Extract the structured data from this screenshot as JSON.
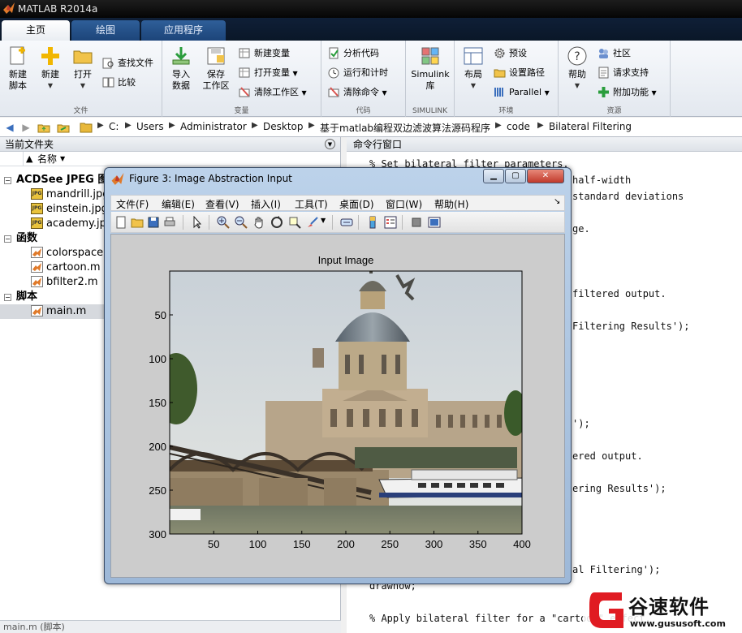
{
  "window": {
    "title": "MATLAB R2014a"
  },
  "tabs": [
    {
      "label": "主页"
    },
    {
      "label": "绘图"
    },
    {
      "label": "应用程序"
    }
  ],
  "ribbon": {
    "file_group": {
      "label": "文件",
      "new_script": "新建\n脚本",
      "new": "新建",
      "open": "打开",
      "find_files": "查找文件",
      "compare": "比较"
    },
    "variable_group": {
      "label": "变量",
      "import": "导入\n数据",
      "save_ws": "保存\n工作区",
      "new_var": "新建变量",
      "open_var": "打开变量",
      "clear_ws": "清除工作区"
    },
    "code_group": {
      "label": "代码",
      "analyze": "分析代码",
      "run_time": "运行和计时",
      "clear_cmd": "清除命令"
    },
    "simulink_group": {
      "label": "SIMULINK",
      "simulink_lib": "Simulink\n库"
    },
    "env_group": {
      "label": "环境",
      "layout": "布局",
      "prefs": "预设",
      "set_path": "设置路径",
      "parallel": "Parallel"
    },
    "resources_group": {
      "label": "资源",
      "help": "帮助",
      "community": "社区",
      "request_support": "请求支持",
      "addons": "附加功能"
    }
  },
  "address": {
    "path": [
      "C:",
      "Users",
      "Administrator",
      "Desktop",
      "基于matlab编程双边滤波算法源码程序",
      "code",
      "Bilateral Filtering"
    ]
  },
  "current_folder": {
    "title": "当前文件夹",
    "col_name": "名称",
    "sections": [
      {
        "label": "ACDSee JPEG 图像",
        "items": [
          "mandrill.jpg",
          "einstein.jpg",
          "academy.jpg"
        ]
      },
      {
        "label": "函数",
        "items": [
          "colorspace.m",
          "cartoon.m",
          "bfilter2.m"
        ]
      },
      {
        "label": "脚本",
        "items": [
          "main.m"
        ]
      }
    ],
    "status": "main.m (脚本)"
  },
  "command_window": {
    "title": "命令行窗口",
    "lines": [
      "% Set bilateral filter parameters.",
      "half-width",
      "standard deviations",
      "ge.",
      "filtered output.",
      "Filtering Results');",
      "');",
      "ered output.",
      "ering Results');",
      "al Filtering');",
      "drawnow;",
      "% Apply bilateral filter for a \"cartoon\" effect."
    ]
  },
  "figure": {
    "title": "Figure 3: Image Abstraction Input",
    "menu": [
      "文件(F)",
      "编辑(E)",
      "查看(V)",
      "插入(I)",
      "工具(T)",
      "桌面(D)",
      "窗口(W)",
      "帮助(H)"
    ],
    "menu_end": "↘"
  },
  "chart_data": {
    "type": "image",
    "title": "Input Image",
    "xlim": [
      0,
      400
    ],
    "ylim": [
      0,
      300
    ],
    "xticks": [
      50,
      100,
      150,
      200,
      250,
      300,
      350,
      400
    ],
    "yticks": [
      50,
      100,
      150,
      200,
      250,
      300
    ],
    "ydir": "reverse"
  },
  "watermark": {
    "brand": "谷速软件",
    "url": "www.gususoft.com"
  }
}
